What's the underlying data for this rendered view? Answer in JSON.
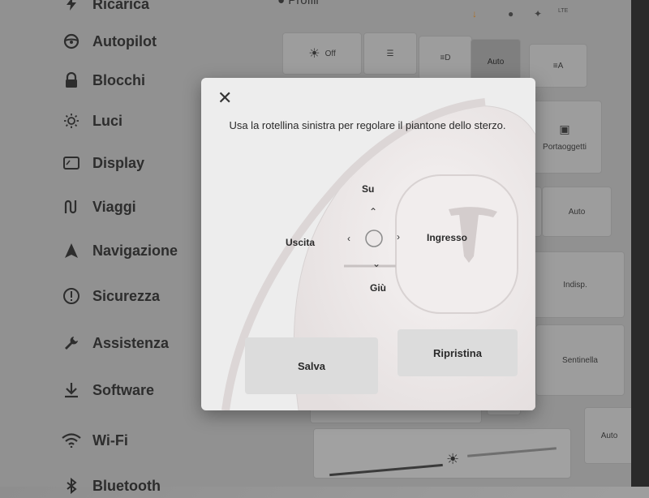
{
  "sidebar": {
    "items": [
      {
        "label": "Ricarica",
        "icon": "lightning-icon"
      },
      {
        "label": "Autopilot",
        "icon": "steering-wheel-icon"
      },
      {
        "label": "Blocchi",
        "icon": "lock-icon"
      },
      {
        "label": "Luci",
        "icon": "sun-icon"
      },
      {
        "label": "Display",
        "icon": "display-icon"
      },
      {
        "label": "Viaggi",
        "icon": "route-icon"
      },
      {
        "label": "Navigazione",
        "icon": "navigation-arrow-icon"
      },
      {
        "label": "Sicurezza",
        "icon": "alert-circle-icon"
      },
      {
        "label": "Assistenza",
        "icon": "wrench-icon"
      },
      {
        "label": "Software",
        "icon": "download-icon"
      },
      {
        "label": "Wi-Fi",
        "icon": "wifi-icon"
      },
      {
        "label": "Bluetooth",
        "icon": "bluetooth-icon"
      }
    ]
  },
  "status": {
    "profile": "Profili",
    "lte": "LTE"
  },
  "lights": {
    "off": "Off",
    "auto": "Auto"
  },
  "background": {
    "portaoggetti": "Portaoggetti",
    "auto2": "Auto",
    "indisp": "Indisp.",
    "sentinella": "Sentinella",
    "auto3": "Auto"
  },
  "modal": {
    "message": "Usa la rotellina sinistra per regolare il piantone dello sterzo.",
    "up": "Su",
    "down": "Giù",
    "left": "Uscita",
    "right": "Ingresso",
    "save": "Salva",
    "reset": "Ripristina"
  }
}
